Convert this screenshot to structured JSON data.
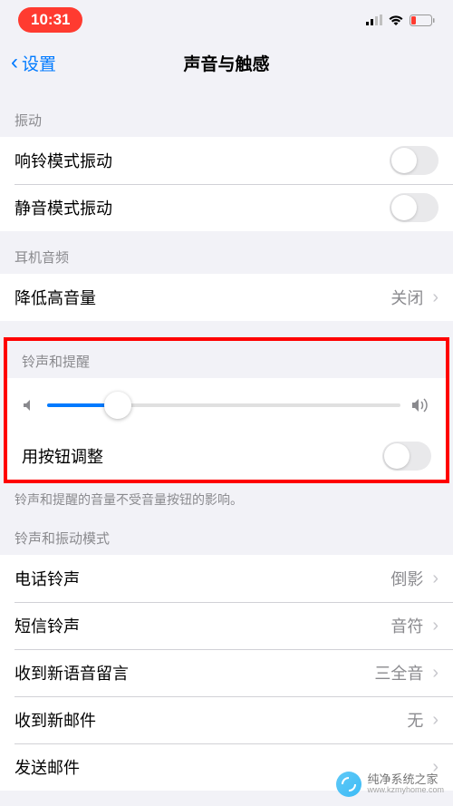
{
  "status": {
    "time": "10:31"
  },
  "nav": {
    "back": "设置",
    "title": "声音与触感"
  },
  "sections": {
    "vibrate": {
      "header": "振动",
      "ring_vibrate": "响铃模式振动",
      "silent_vibrate": "静音模式振动"
    },
    "headphone": {
      "header": "耳机音频",
      "reduce_loud": "降低高音量",
      "reduce_loud_value": "关闭"
    },
    "ringer": {
      "header": "铃声和提醒",
      "button_adjust": "用按钮调整",
      "footer": "铃声和提醒的音量不受音量按钮的影响。",
      "slider_value": 20
    },
    "patterns": {
      "header": "铃声和振动模式",
      "ringtone": "电话铃声",
      "ringtone_value": "倒影",
      "text_tone": "短信铃声",
      "text_tone_value": "音符",
      "voicemail": "收到新语音留言",
      "voicemail_value": "三全音",
      "new_mail": "收到新邮件",
      "new_mail_value": "无",
      "sent_mail": "发送邮件"
    }
  },
  "watermark": {
    "title": "纯净系统之家",
    "url": "www.kzmyhome.com"
  }
}
